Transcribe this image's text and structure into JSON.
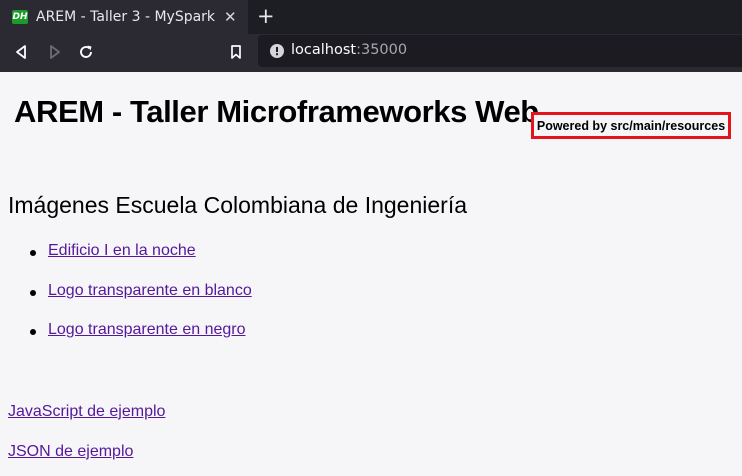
{
  "browser": {
    "tab": {
      "favicon_text": "DH",
      "title": "AREM - Taller 3 - MySpark",
      "close_glyph": "✕"
    },
    "new_tab_glyph": "+",
    "url": {
      "host": "localhost",
      "port": ":35000"
    }
  },
  "page": {
    "title": "AREM - Taller Microframeworks Web",
    "powered_by": "Powered by src/main/resources",
    "section_heading": "Imágenes Escuela Colombiana de Ingeniería",
    "image_links": [
      "Edificio I en la noche",
      "Logo transparente en blanco",
      "Logo transparente en negro"
    ],
    "js_link": "JavaScript de ejemplo",
    "json_link": "JSON de ejemplo"
  },
  "colors": {
    "link": "#55189b",
    "badge_border": "#e5131b",
    "background": "#f6f6f9"
  }
}
